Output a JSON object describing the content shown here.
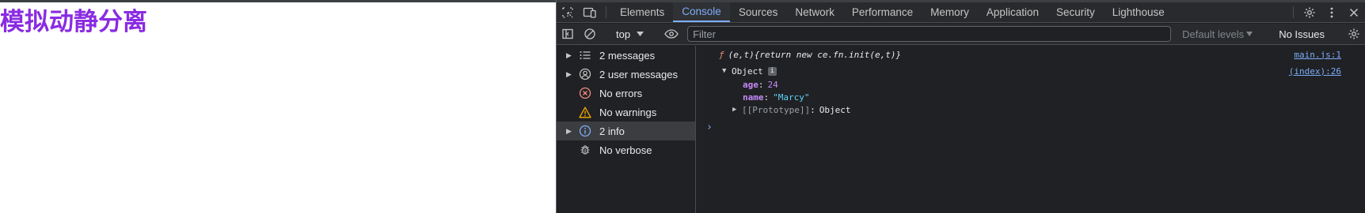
{
  "page": {
    "title": "模拟动静分离"
  },
  "devtools": {
    "tabs": [
      {
        "label": "Elements",
        "active": false
      },
      {
        "label": "Console",
        "active": true
      },
      {
        "label": "Sources",
        "active": false
      },
      {
        "label": "Network",
        "active": false
      },
      {
        "label": "Performance",
        "active": false
      },
      {
        "label": "Memory",
        "active": false
      },
      {
        "label": "Application",
        "active": false
      },
      {
        "label": "Security",
        "active": false
      },
      {
        "label": "Lighthouse",
        "active": false
      }
    ],
    "toolbar": {
      "context": "top",
      "filter_placeholder": "Filter",
      "levels_label": "Default levels",
      "issues_label": "No Issues"
    },
    "sidebar": {
      "items": [
        {
          "label": "2 messages",
          "icon": "list-icon",
          "expandable": true
        },
        {
          "label": "2 user messages",
          "icon": "user-icon",
          "expandable": true
        },
        {
          "label": "No errors",
          "icon": "error-icon",
          "expandable": false
        },
        {
          "label": "No warnings",
          "icon": "warning-icon",
          "expandable": false
        },
        {
          "label": "2 info",
          "icon": "info-icon",
          "expandable": true
        },
        {
          "label": "No verbose",
          "icon": "bug-icon",
          "expandable": false
        }
      ]
    },
    "console": {
      "fn_prefix": "ƒ",
      "fn_text": "(e,t){return new ce.fn.init(e,t)}",
      "fn_source": "main.js:1",
      "object_label": "Object",
      "object_badge": "i",
      "object_source": "(index):26",
      "props": [
        {
          "key": "age",
          "value": "24",
          "type": "number"
        },
        {
          "key": "name",
          "value": "\"Marcy\"",
          "type": "string"
        }
      ],
      "proto_key": "[[Prototype]]",
      "proto_value": "Object",
      "prompt": "›"
    },
    "colors": {
      "accent": "#7cacf8",
      "background": "#202124",
      "title_purple": "#8a2be2"
    }
  }
}
